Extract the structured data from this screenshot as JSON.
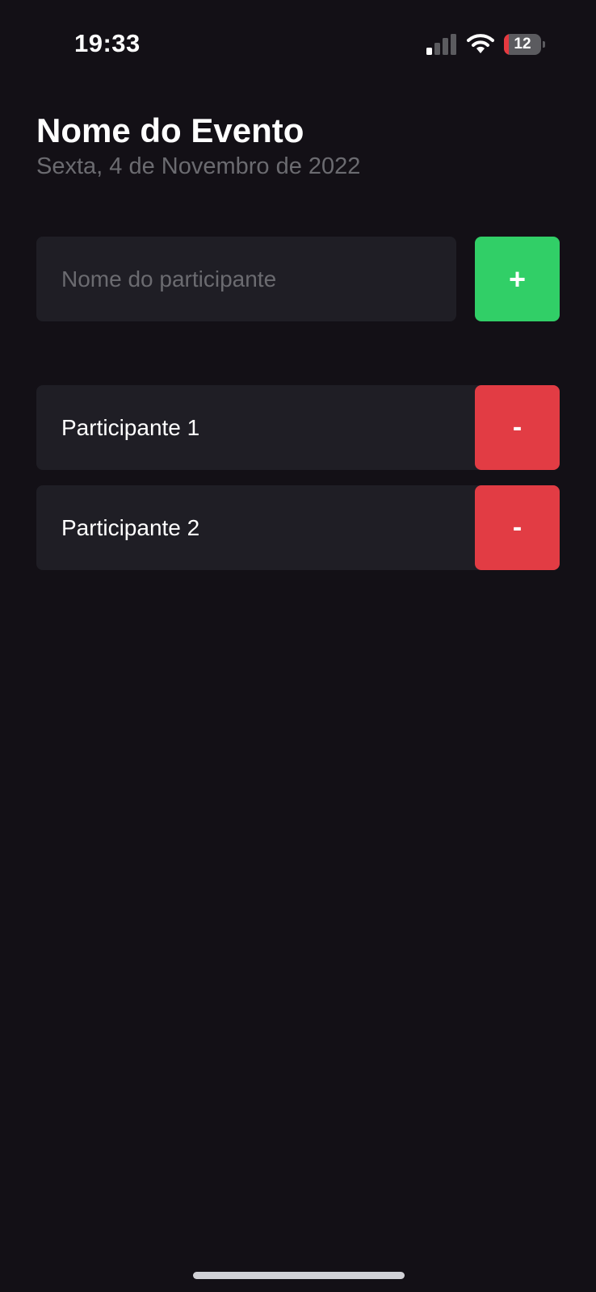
{
  "status_bar": {
    "time": "19:33",
    "battery_level": "12",
    "battery_percent": 12,
    "signal_icon": "cellular-signal-icon",
    "wifi_icon": "wifi-icon",
    "battery_icon": "battery-icon"
  },
  "header": {
    "title": "Nome do Evento",
    "subtitle": "Sexta, 4 de Novembro de 2022"
  },
  "form": {
    "placeholder": "Nome do participante",
    "add_label": "+"
  },
  "participants": [
    {
      "name": "Participante 1",
      "remove_label": "-"
    },
    {
      "name": "Participante 2",
      "remove_label": "-"
    }
  ],
  "colors": {
    "background": "#131016",
    "card": "#1f1e25",
    "add": "#31cf67",
    "remove": "#e23c44",
    "muted_text": "#6b6b70"
  }
}
